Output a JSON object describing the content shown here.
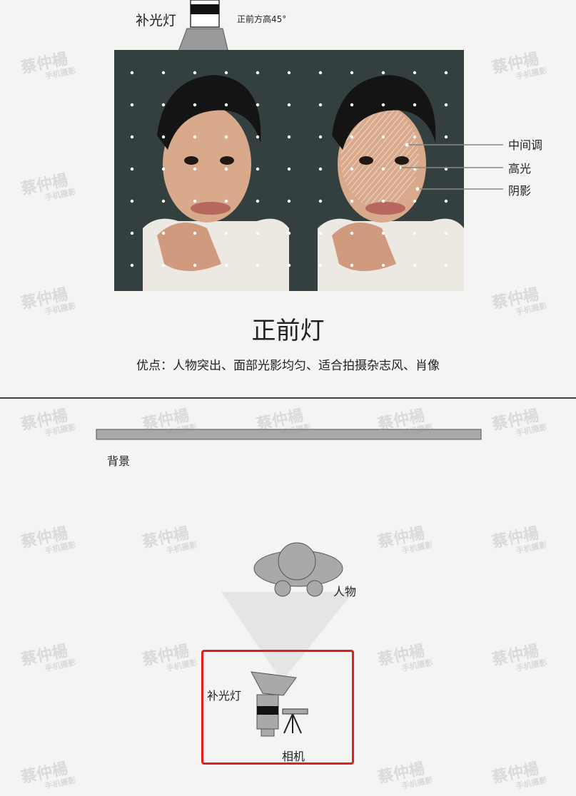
{
  "top_light_label": "补光灯",
  "top_light_position": "正前方高45°",
  "callouts": {
    "midtone": "中间调",
    "highlight": "高光",
    "shadow": "阴影"
  },
  "title": "正前灯",
  "advantages": "优点：人物突出、面部光影均匀、适合拍摄杂志风、肖像",
  "diagram": {
    "background_label": "背景",
    "person_label": "人物",
    "light_label": "补光灯",
    "camera_label": "相机"
  },
  "watermark": {
    "name": "蔡仲楊",
    "sub": "手机摄影"
  },
  "colors": {
    "highlight_box": "#e0201e",
    "shape_fill": "#a9a9a9",
    "photo_bg": "#2f3a3a"
  }
}
